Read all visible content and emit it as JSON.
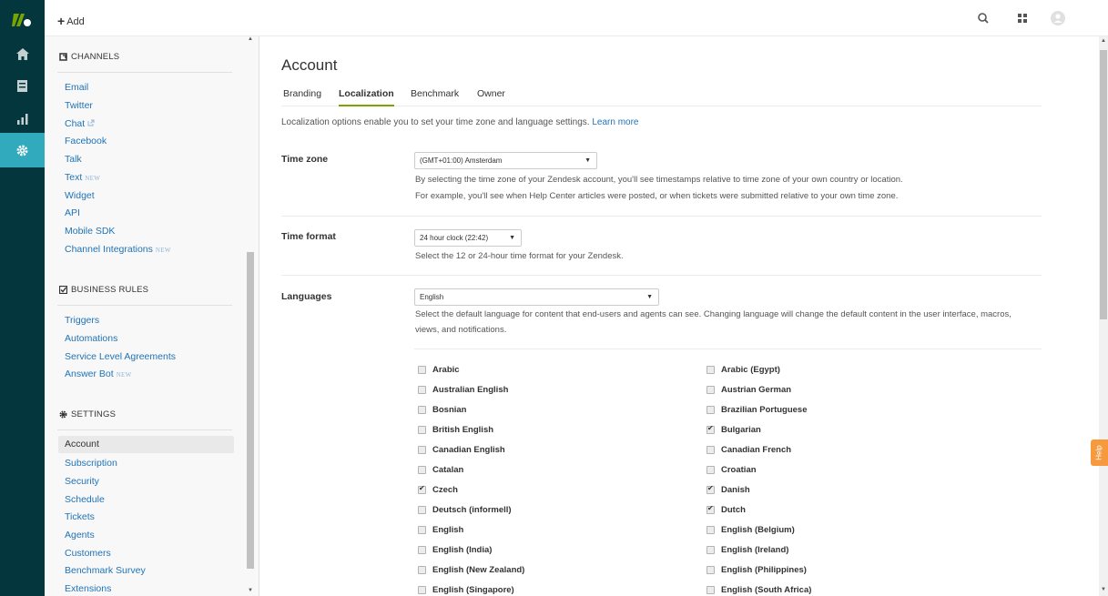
{
  "topbar": {
    "add_label": "Add",
    "icons": [
      "search-icon",
      "apps-icon",
      "avatar-icon"
    ]
  },
  "rail": {
    "items": [
      "zendesk-logo",
      "home-icon",
      "views-icon",
      "reporting-icon",
      "admin-gear-icon"
    ],
    "active": "admin-gear-icon"
  },
  "sidebar": {
    "channels": {
      "heading": "CHANNELS",
      "items": [
        {
          "label": "Email"
        },
        {
          "label": "Twitter"
        },
        {
          "label": "Chat",
          "external": true
        },
        {
          "label": "Facebook"
        },
        {
          "label": "Talk"
        },
        {
          "label": "Text",
          "badge": "NEW"
        },
        {
          "label": "Widget"
        },
        {
          "label": "API"
        },
        {
          "label": "Mobile SDK"
        },
        {
          "label": "Channel Integrations",
          "badge": "NEW"
        }
      ]
    },
    "business_rules": {
      "heading": "BUSINESS RULES",
      "items": [
        {
          "label": "Triggers"
        },
        {
          "label": "Automations"
        },
        {
          "label": "Service Level Agreements"
        },
        {
          "label": "Answer Bot",
          "badge": "NEW"
        }
      ]
    },
    "settings": {
      "heading": "SETTINGS",
      "items": [
        {
          "label": "Account",
          "active": true
        },
        {
          "label": "Subscription"
        },
        {
          "label": "Security"
        },
        {
          "label": "Schedule"
        },
        {
          "label": "Tickets"
        },
        {
          "label": "Agents"
        },
        {
          "label": "Customers"
        },
        {
          "label": "Benchmark Survey"
        },
        {
          "label": "Extensions"
        }
      ]
    }
  },
  "main": {
    "title": "Account",
    "tabs": [
      {
        "label": "Branding"
      },
      {
        "label": "Localization",
        "active": true
      },
      {
        "label": "Benchmark"
      },
      {
        "label": "Owner"
      }
    ],
    "intro": "Localization options enable you to set your time zone and language settings.",
    "intro_link": "Learn more",
    "time_zone": {
      "label": "Time zone",
      "value": "(GMT+01:00) Amsterdam",
      "help1": "By selecting the time zone of your Zendesk account, you'll see timestamps relative to time zone of your own country or location.",
      "help2": "For example, you'll see when Help Center articles were posted, or when tickets were submitted relative to your own time zone."
    },
    "time_format": {
      "label": "Time format",
      "value": "24 hour clock (22:42)",
      "help": "Select the 12 or 24-hour time format for your Zendesk."
    },
    "languages": {
      "label": "Languages",
      "value": "English",
      "help1": "Select the default language for content that end-users and agents can see. Changing language will change the default content in the user interface, macros,",
      "help2": "views, and notifications.",
      "list": [
        {
          "name": "Arabic",
          "checked": false
        },
        {
          "name": "Arabic (Egypt)",
          "checked": false
        },
        {
          "name": "Australian English",
          "checked": false
        },
        {
          "name": "Austrian German",
          "checked": false
        },
        {
          "name": "Bosnian",
          "checked": false
        },
        {
          "name": "Brazilian Portuguese",
          "checked": false
        },
        {
          "name": "British English",
          "checked": false
        },
        {
          "name": "Bulgarian",
          "checked": true
        },
        {
          "name": "Canadian English",
          "checked": false
        },
        {
          "name": "Canadian French",
          "checked": false
        },
        {
          "name": "Catalan",
          "checked": false
        },
        {
          "name": "Croatian",
          "checked": false
        },
        {
          "name": "Czech",
          "checked": true
        },
        {
          "name": "Danish",
          "checked": true
        },
        {
          "name": "Deutsch (informell)",
          "checked": false
        },
        {
          "name": "Dutch",
          "checked": true
        },
        {
          "name": "English",
          "checked": false
        },
        {
          "name": "English (Belgium)",
          "checked": false
        },
        {
          "name": "English (India)",
          "checked": false
        },
        {
          "name": "English (Ireland)",
          "checked": false
        },
        {
          "name": "English (New Zealand)",
          "checked": false
        },
        {
          "name": "English (Philippines)",
          "checked": false
        },
        {
          "name": "English (Singapore)",
          "checked": false
        },
        {
          "name": "English (South Africa)",
          "checked": false
        }
      ]
    }
  },
  "help_tab": {
    "label": "Help"
  },
  "colors": {
    "rail": "#03363d",
    "accent": "#30aabc",
    "link": "#1f73b7",
    "tab_underline": "#78a300",
    "help": "#f79a3e"
  }
}
